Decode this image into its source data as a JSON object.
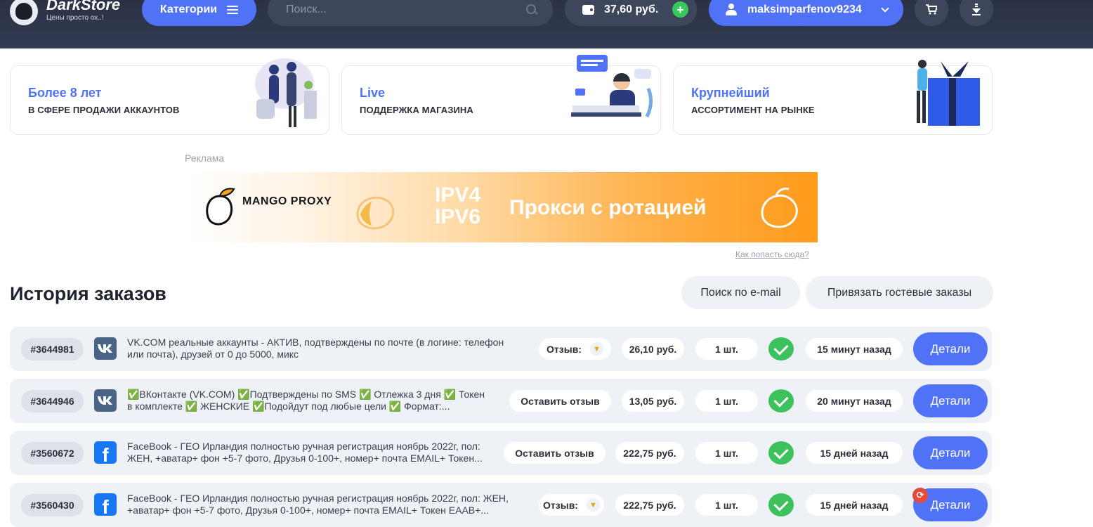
{
  "header": {
    "logo_title": "DarkStore",
    "logo_subtitle": "Цены просто ох..!",
    "categories_label": "Категории",
    "search_placeholder": "Поиск...",
    "balance": "37,60 руб.",
    "balance_add": "+",
    "username": "maksimparfenov9234"
  },
  "features": [
    {
      "title": "Более 8 лет",
      "subtitle": "В СФЕРЕ ПРОДАЖИ АККАУНТОВ"
    },
    {
      "title": "Live",
      "subtitle": "ПОДДЕРЖКА МАГАЗИНА"
    },
    {
      "title": "Крупнейший",
      "subtitle": "АССОРТИМЕНТ НА РЫНКЕ"
    }
  ],
  "ad": {
    "label": "Реклама",
    "brand": "MANGO PROXY",
    "ipv4": "IPV4",
    "ipv6": "IPV6",
    "slogan": "Прокси с ротацией",
    "link": "Как попасть сюда?"
  },
  "orders": {
    "title": "История заказов",
    "search_email": "Поиск по e-mail",
    "bind_guest": "Привязать гостевые заказы",
    "review_label": "Отзыв:",
    "leave_review": "Оставить отзыв",
    "details": "Детали",
    "items": [
      {
        "id": "#3644981",
        "platform": "vk",
        "platform_text": "VK",
        "desc_1": "VK.COM реальные аккаунты - АКТИВ, подтверждены по почте (в логине: телефон",
        "desc_2": "или почта), друзей от 0 до 5000, микс",
        "price": "26,10 руб.",
        "qty": "1 шт.",
        "time": "15 минут назад",
        "reviewed": true
      },
      {
        "id": "#3644946",
        "platform": "vk",
        "platform_text": "VK",
        "desc_1": "✅ВКонтакте (VK.COM) ✅Подтверждены по SMS ✅ Отлежка 3 дня ✅ Токен",
        "desc_2": "в комплекте ✅ ЖЕНСКИЕ ✅Подойдут под любые цели ✅ Формат:...",
        "price": "13,05 руб.",
        "qty": "1 шт.",
        "time": "20 минут назад",
        "reviewed": false
      },
      {
        "id": "#3560672",
        "platform": "fb",
        "platform_text": "f",
        "desc_1": "FaceBook - ГЕО Ирландия полностью ручная регистрация ноябрь 2022г, пол:",
        "desc_2": "ЖЕН, +аватар+ фон +5-7 фото, Друзья 0-100+, номер+ почта EMAIL+ Токен...",
        "price": "222,75 руб.",
        "qty": "1 шт.",
        "time": "15 дней назад",
        "reviewed": false
      },
      {
        "id": "#3560430",
        "platform": "fb",
        "platform_text": "f",
        "desc_1": "FaceBook - ГЕО Ирландия полностью ручная регистрация ноябрь 2022г, пол: ЖЕН,",
        "desc_2": "+аватар+ фон +5-7 фото, Друзья 0-100+, номер+ почта EMAIL+ Токен EAAB+...",
        "price": "222,75 руб.",
        "qty": "1 шт.",
        "time": "15 дней назад",
        "reviewed": true
      }
    ]
  },
  "colors": {
    "accent": "#4f72f6",
    "header_bg": "#2b3245",
    "success": "#3cc15c",
    "row_bg": "#eef1f6"
  }
}
